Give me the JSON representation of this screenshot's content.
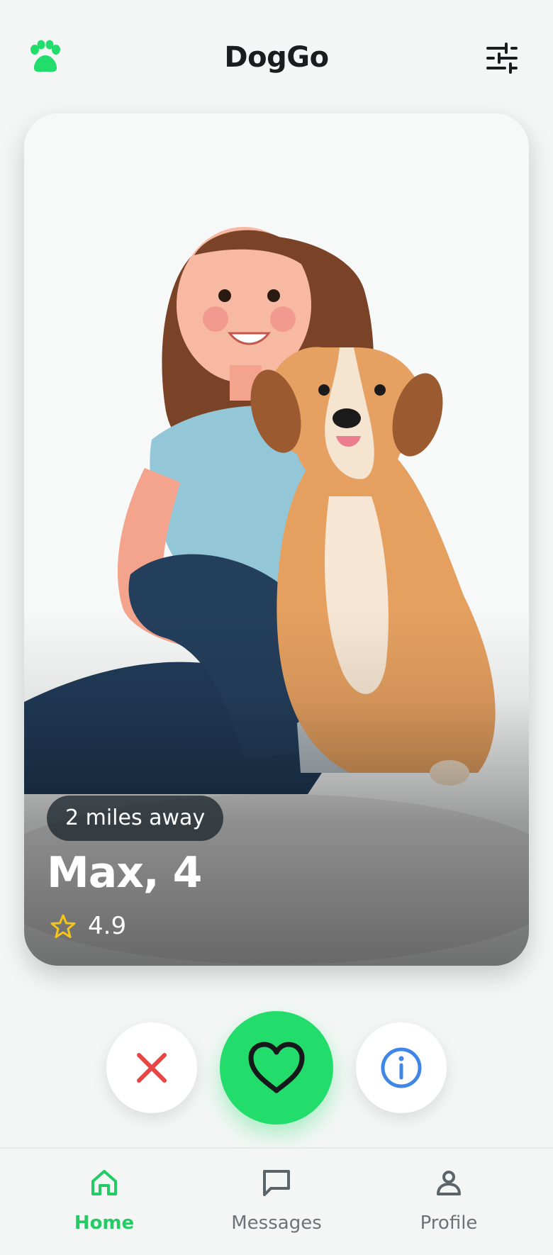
{
  "app": {
    "title": "DogGo"
  },
  "card": {
    "distance": "2 miles away",
    "name_age": "Max, 4",
    "rating": "4.9"
  },
  "actions": {
    "pass_icon": "close-icon",
    "like_icon": "heart-icon",
    "info_icon": "info-icon"
  },
  "tabs": [
    {
      "label": "Home",
      "icon": "home-icon",
      "active": true
    },
    {
      "label": "Messages",
      "icon": "chat-icon",
      "active": false
    },
    {
      "label": "Profile",
      "icon": "person-icon",
      "active": false
    }
  ],
  "colors": {
    "accent": "#22dd6b",
    "pass": "#e84545",
    "info": "#3f86e6",
    "star": "#f5c518"
  }
}
